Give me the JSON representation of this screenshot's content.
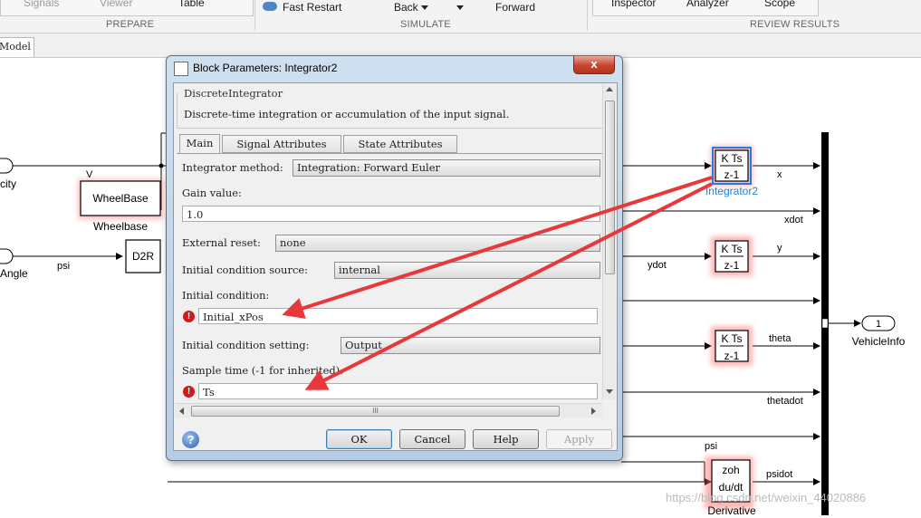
{
  "ribbon": {
    "prepare_items": [
      "Signals",
      "Viewer",
      "Table"
    ],
    "simulate_items": {
      "fast_restart": "Fast Restart",
      "back": "Back",
      "forward": "Forward"
    },
    "review_items": [
      "Inspector",
      "Analyzer",
      "Scope"
    ],
    "sections": {
      "prepare": "PREPARE",
      "simulate": "SIMULATE",
      "review": "REVIEW RESULTS"
    }
  },
  "tabstrip": {
    "model_tab": "Model"
  },
  "diagram": {
    "signals": {
      "v": "V",
      "psi": "psi",
      "x": "x",
      "xdot": "xdot",
      "y": "y",
      "ydot": "ydot",
      "theta": "theta",
      "thetadot": "thetadot",
      "psi2": "psi",
      "psidot": "psidot"
    },
    "inports": {
      "velocity": "city",
      "angle": "Angle"
    },
    "blocks": {
      "wheelbase": {
        "text": "WheelBase",
        "label": "Wheelbase"
      },
      "d2r": {
        "text": "D2R"
      },
      "integrator_top": "K Ts",
      "integrator_bottom": "z-1",
      "integrator2_label": "Integrator2",
      "derivative": {
        "top": "zoh",
        "bottom": "du/dt",
        "label": "Derivative"
      }
    },
    "outport": {
      "number": "1",
      "label": "VehicleInfo"
    },
    "arrow_color": "#e8383b",
    "highlight_color": "#ff6b6b",
    "selection_color": "#1f7fe0"
  },
  "dialog": {
    "title": "Block Parameters: Integrator2",
    "close_glyph": "x",
    "group_title": "DiscreteIntegrator",
    "description": "Discrete-time integration or accumulation of the input signal.",
    "tabs": [
      "Main",
      "Signal Attributes",
      "State Attributes"
    ],
    "integrator_method": {
      "label": "Integrator method:",
      "value": "Integration: Forward Euler"
    },
    "gain": {
      "label": "Gain value:",
      "value": "1.0"
    },
    "external_reset": {
      "label": "External reset:",
      "value": "none"
    },
    "ic_source": {
      "label": "Initial condition source:",
      "value": "internal"
    },
    "initial_condition": {
      "label": "Initial condition:",
      "value": "Initial_xPos",
      "error": "!"
    },
    "ic_setting": {
      "label": "Initial condition setting:",
      "value": "Output"
    },
    "sample_time": {
      "label": "Sample time (-1 for inherited):",
      "value": "Ts",
      "error": "!"
    },
    "hscroll_grip": "III",
    "help_icon": "?",
    "buttons": {
      "ok": "OK",
      "cancel": "Cancel",
      "help": "Help",
      "apply": "Apply"
    }
  },
  "watermark": "https://blog.csdn.net/weixin_44020886"
}
